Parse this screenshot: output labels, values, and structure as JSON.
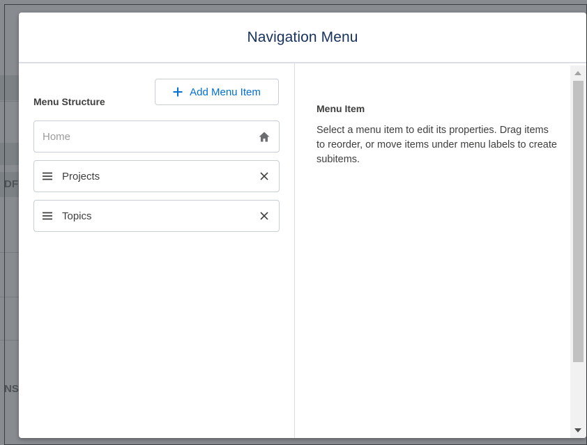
{
  "modal": {
    "title": "Navigation Menu"
  },
  "menu_structure": {
    "heading": "Menu Structure",
    "add_button_label": "Add Menu Item",
    "items": [
      {
        "label": "Home",
        "icon": "home-icon"
      },
      {
        "label": "Projects",
        "icon": "close-icon"
      },
      {
        "label": "Topics",
        "icon": "close-icon"
      }
    ]
  },
  "detail": {
    "heading": "Menu Item",
    "description": "Select a menu item to edit its properties. Drag items to reorder, or move items under menu labels to create subitems."
  },
  "background": {
    "fragment_left_1": "DF",
    "fragment_left_2": "NS"
  },
  "colors": {
    "accent": "#0070d2",
    "title": "#16325c",
    "text": "#3e3e3c",
    "border": "#c9ced6"
  }
}
